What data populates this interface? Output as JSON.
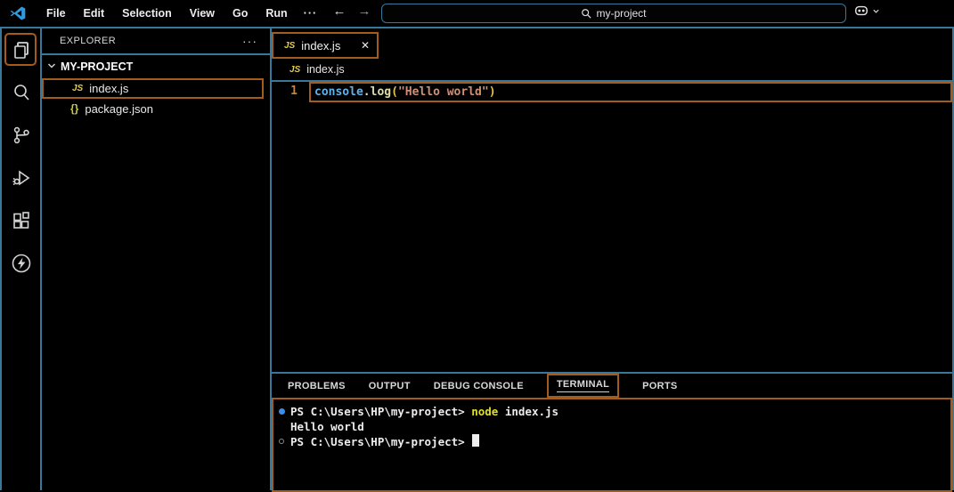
{
  "titlebar": {
    "menus": [
      "File",
      "Edit",
      "Selection",
      "View",
      "Go",
      "Run"
    ],
    "overflow": "···",
    "nav": {
      "back": "←",
      "forward": "→"
    },
    "search": {
      "value": "my-project"
    }
  },
  "activity_bar": {
    "items": [
      {
        "icon": "files-icon",
        "active": true
      },
      {
        "icon": "search-icon",
        "active": false
      },
      {
        "icon": "source-control-icon",
        "active": false
      },
      {
        "icon": "run-debug-icon",
        "active": false
      },
      {
        "icon": "extensions-icon",
        "active": false
      },
      {
        "icon": "lightning-icon",
        "active": false
      }
    ]
  },
  "sidebar": {
    "title": "EXPLORER",
    "more": "···",
    "section": {
      "label": "MY-PROJECT",
      "expanded": true
    },
    "files": [
      {
        "icon": "JS",
        "name": "index.js",
        "selected": true
      },
      {
        "icon": "{}",
        "name": "package.json",
        "selected": false
      }
    ]
  },
  "editor": {
    "tab": {
      "icon": "JS",
      "label": "index.js",
      "close": "✕"
    },
    "breadcrumb": {
      "icon": "JS",
      "label": "index.js"
    },
    "code": {
      "line_number": "1",
      "tokens": [
        {
          "text": "console",
          "color": "#5fb2e8"
        },
        {
          "text": ".",
          "color": "#d4d4d4"
        },
        {
          "text": "log",
          "color": "#dcdcaa"
        },
        {
          "text": "(",
          "color": "#e6c14c"
        },
        {
          "text": "\"Hello world\"",
          "color": "#ce9178"
        },
        {
          "text": ")",
          "color": "#e6c14c"
        }
      ]
    }
  },
  "panel": {
    "tabs": [
      "PROBLEMS",
      "OUTPUT",
      "DEBUG CONSOLE",
      "TERMINAL",
      "PORTS"
    ],
    "active_tab": "TERMINAL",
    "terminal": {
      "lines": [
        {
          "marker": "filled-circle",
          "prompt": "PS C:\\Users\\HP\\my-project> ",
          "command": "node",
          "suffix": " index.js"
        },
        {
          "output": "Hello world"
        },
        {
          "marker": "hollow-circle",
          "prompt": "PS C:\\Users\\HP\\my-project> ",
          "cursor": "block"
        }
      ]
    }
  },
  "colors": {
    "background": "#000000",
    "border_blue": "#38789a",
    "highlight_orange": "#a35b1e",
    "js_icon_yellow": "#e3cd4b",
    "json_icon_yellow": "#cbcb41",
    "string_orange": "#ce9178",
    "terminal_command_yellow": "#e0e020",
    "terminal_decoration_blue": "#3b8eea"
  }
}
